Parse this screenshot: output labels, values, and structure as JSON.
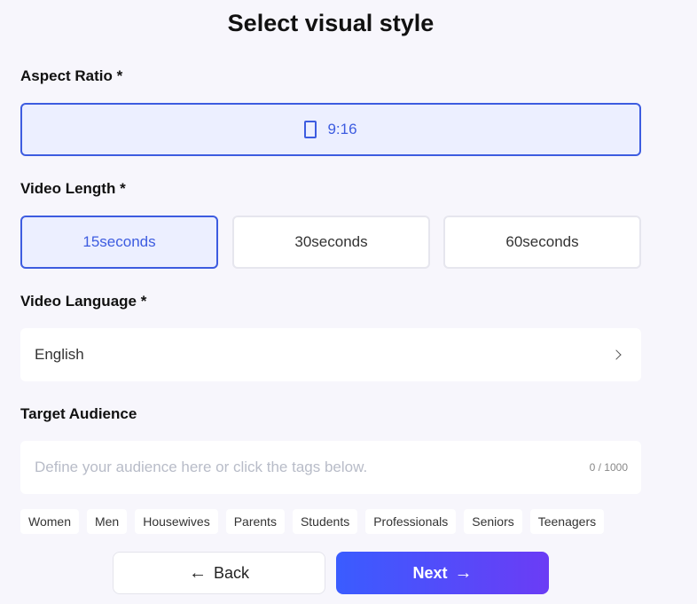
{
  "page": {
    "title": "Select visual style"
  },
  "aspect_ratio": {
    "label": "Aspect Ratio *",
    "selected": "9:16",
    "icon": "phone-portrait-icon"
  },
  "video_length": {
    "label": "Video Length *",
    "options": [
      "15seconds",
      "30seconds",
      "60seconds"
    ],
    "selected": "15seconds"
  },
  "video_language": {
    "label": "Video Language *",
    "value": "English",
    "icon": "chevron-right-icon"
  },
  "target_audience": {
    "label": "Target Audience",
    "placeholder": "Define your audience here or click the tags below.",
    "value": "",
    "counter": "0 / 1000",
    "tags": [
      "Women",
      "Men",
      "Housewives",
      "Parents",
      "Students",
      "Professionals",
      "Seniors",
      "Teenagers"
    ]
  },
  "actions": {
    "back_label": "Back",
    "back_icon": "←",
    "next_label": "Next",
    "next_icon": "→"
  },
  "colors": {
    "accent": "#3d5ce0",
    "selected_bg": "#ecefff",
    "next_gradient_start": "#3a5cff",
    "next_gradient_end": "#6b3cf5"
  }
}
